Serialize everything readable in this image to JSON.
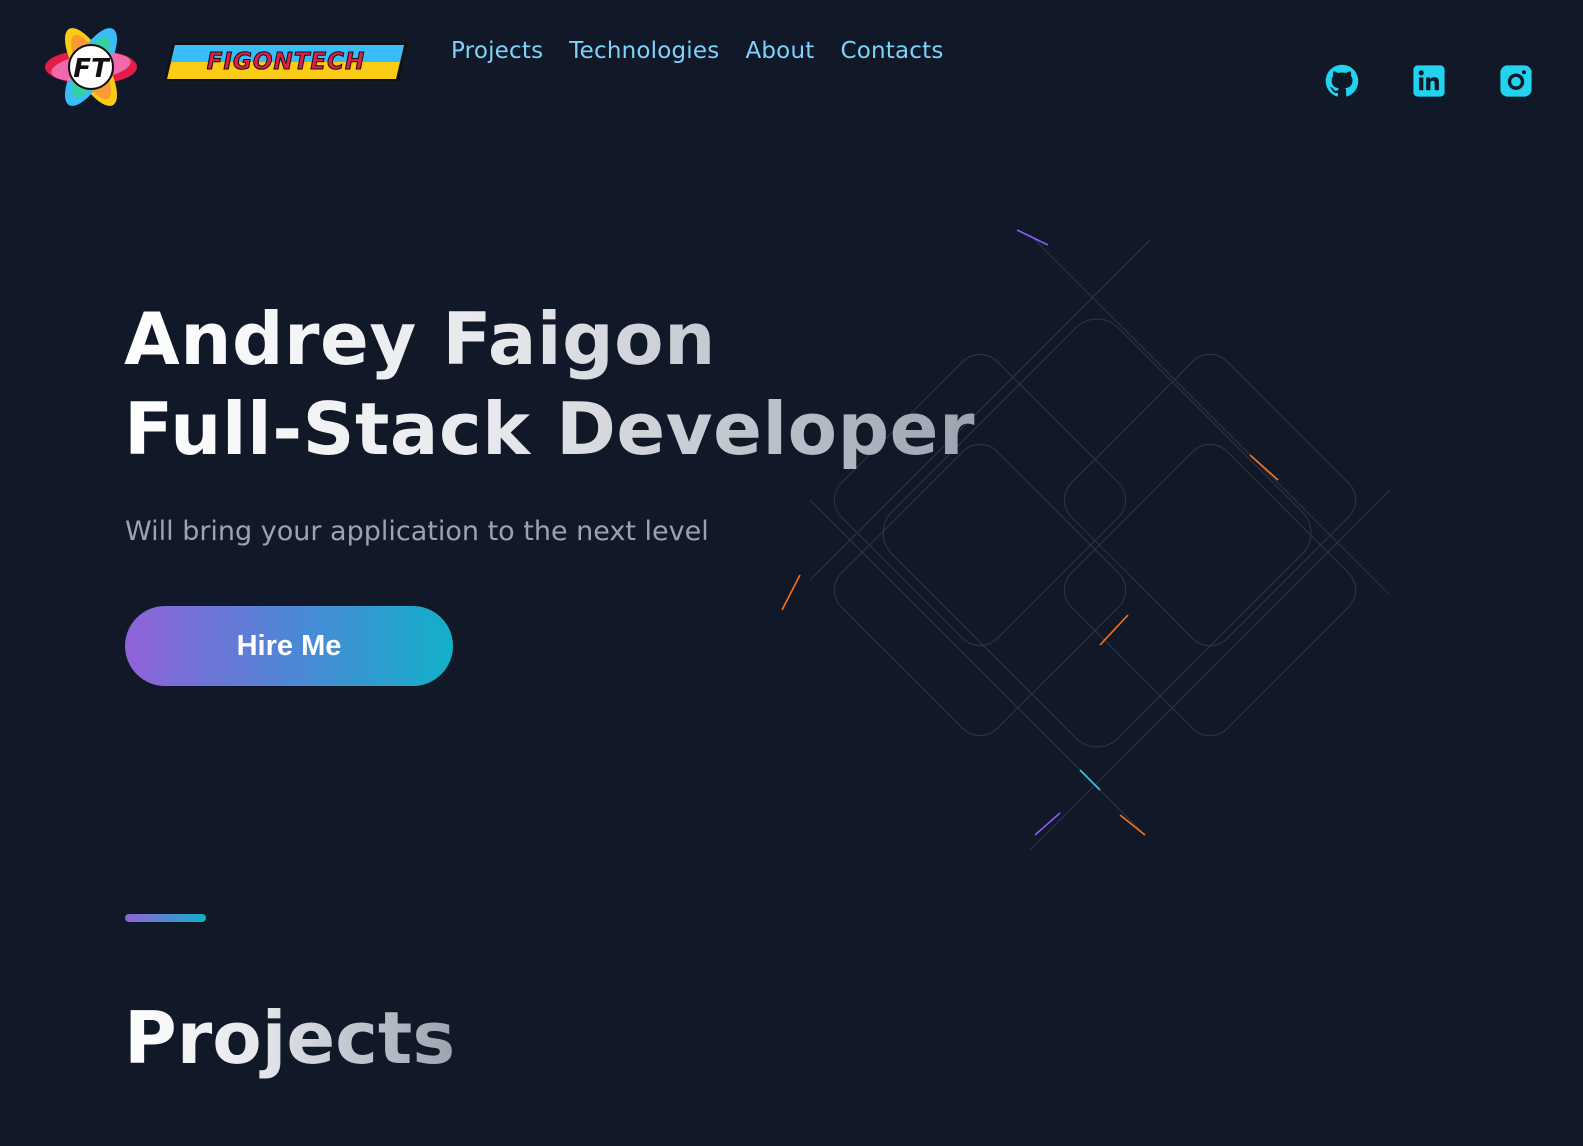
{
  "brand": {
    "mark_text": "FT",
    "wordmark": "FIGONTECH"
  },
  "nav": {
    "items": [
      {
        "label": "Projects"
      },
      {
        "label": "Technologies"
      },
      {
        "label": "About"
      },
      {
        "label": "Contacts"
      }
    ]
  },
  "socials": [
    {
      "icon": "github-icon"
    },
    {
      "icon": "linkedin-icon"
    },
    {
      "icon": "instagram-icon"
    }
  ],
  "hero": {
    "title_line1": "Andrey Faigon",
    "title_line2": "Full-Stack Developer",
    "subtitle": "Will bring your application to the next level",
    "cta_label": "Hire Me"
  },
  "projects_section": {
    "title": "Projects"
  },
  "colors": {
    "background": "#111827",
    "nav_link": "#7dd3fc",
    "social_icon": "#22d3ee",
    "gradient_start": "#9062d9",
    "gradient_end": "#12b0c9"
  }
}
